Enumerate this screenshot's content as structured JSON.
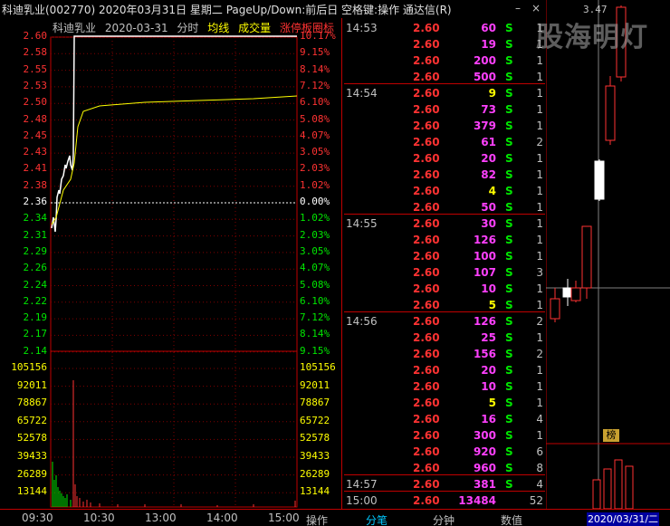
{
  "title": "科迪乳业(002770)  2020年03月31日 星期二  PageUp/Down:前后日  空格键:操作  通达信(R)",
  "window_controls": {
    "minimize": "–",
    "close": "×"
  },
  "chart_header": {
    "name": "科迪乳业",
    "date": "2020-03-31",
    "mode": "分时",
    "avg_label": "均线",
    "vol_label": "成交量",
    "limit_label": "涨停板圈标"
  },
  "chart_data": {
    "type": "line",
    "price_axis_left": [
      "2.60",
      "2.58",
      "2.55",
      "2.53",
      "2.50",
      "2.48",
      "2.45",
      "2.43",
      "2.41",
      "2.38",
      "2.36",
      "2.34",
      "2.31",
      "2.29",
      "2.26",
      "2.24",
      "2.22",
      "2.19",
      "2.17",
      "2.14"
    ],
    "price_axis_right": [
      "10.17%",
      "9.15%",
      "8.14%",
      "7.12%",
      "6.10%",
      "5.08%",
      "4.07%",
      "3.05%",
      "2.03%",
      "1.02%",
      "0.00%",
      "1.02%",
      "2.03%",
      "3.05%",
      "4.07%",
      "5.08%",
      "6.10%",
      "7.12%",
      "8.14%",
      "9.15%"
    ],
    "volume_axis": [
      "105156",
      "92011",
      "78867",
      "65722",
      "52578",
      "39433",
      "26289",
      "13144"
    ],
    "x_ticks": [
      "09:30",
      "10:30",
      "13:00",
      "14:00",
      "15:00"
    ],
    "prev_close": 2.36,
    "ylim": [
      2.13,
      2.61
    ]
  },
  "ticks": [
    {
      "time": "14:53",
      "price": "2.60",
      "vol": "60",
      "dir": "S",
      "cnt": "1"
    },
    {
      "time": "",
      "price": "2.60",
      "vol": "19",
      "dir": "S",
      "cnt": "1"
    },
    {
      "time": "",
      "price": "2.60",
      "vol": "200",
      "dir": "S",
      "cnt": "1"
    },
    {
      "time": "",
      "price": "2.60",
      "vol": "500",
      "dir": "S",
      "cnt": "1"
    },
    {
      "time": "14:54",
      "price": "2.60",
      "vol": "9",
      "dir": "S",
      "cnt": "1",
      "yellow": true
    },
    {
      "time": "",
      "price": "2.60",
      "vol": "73",
      "dir": "S",
      "cnt": "1"
    },
    {
      "time": "",
      "price": "2.60",
      "vol": "379",
      "dir": "S",
      "cnt": "1"
    },
    {
      "time": "",
      "price": "2.60",
      "vol": "61",
      "dir": "S",
      "cnt": "2"
    },
    {
      "time": "",
      "price": "2.60",
      "vol": "20",
      "dir": "S",
      "cnt": "1"
    },
    {
      "time": "",
      "price": "2.60",
      "vol": "82",
      "dir": "S",
      "cnt": "1"
    },
    {
      "time": "",
      "price": "2.60",
      "vol": "4",
      "dir": "S",
      "cnt": "1",
      "yellow": true
    },
    {
      "time": "",
      "price": "2.60",
      "vol": "50",
      "dir": "S",
      "cnt": "1"
    },
    {
      "time": "14:55",
      "price": "2.60",
      "vol": "30",
      "dir": "S",
      "cnt": "1"
    },
    {
      "time": "",
      "price": "2.60",
      "vol": "126",
      "dir": "S",
      "cnt": "1"
    },
    {
      "time": "",
      "price": "2.60",
      "vol": "100",
      "dir": "S",
      "cnt": "1"
    },
    {
      "time": "",
      "price": "2.60",
      "vol": "107",
      "dir": "S",
      "cnt": "3"
    },
    {
      "time": "",
      "price": "2.60",
      "vol": "10",
      "dir": "S",
      "cnt": "1"
    },
    {
      "time": "",
      "price": "2.60",
      "vol": "5",
      "dir": "S",
      "cnt": "1",
      "yellow": true
    },
    {
      "time": "14:56",
      "price": "2.60",
      "vol": "126",
      "dir": "S",
      "cnt": "2"
    },
    {
      "time": "",
      "price": "2.60",
      "vol": "25",
      "dir": "S",
      "cnt": "1"
    },
    {
      "time": "",
      "price": "2.60",
      "vol": "156",
      "dir": "S",
      "cnt": "2"
    },
    {
      "time": "",
      "price": "2.60",
      "vol": "20",
      "dir": "S",
      "cnt": "1"
    },
    {
      "time": "",
      "price": "2.60",
      "vol": "10",
      "dir": "S",
      "cnt": "1"
    },
    {
      "time": "",
      "price": "2.60",
      "vol": "5",
      "dir": "S",
      "cnt": "1",
      "yellow": true
    },
    {
      "time": "",
      "price": "2.60",
      "vol": "16",
      "dir": "S",
      "cnt": "4"
    },
    {
      "time": "",
      "price": "2.60",
      "vol": "300",
      "dir": "S",
      "cnt": "1"
    },
    {
      "time": "",
      "price": "2.60",
      "vol": "920",
      "dir": "S",
      "cnt": "6"
    },
    {
      "time": "",
      "price": "2.60",
      "vol": "960",
      "dir": "S",
      "cnt": "8"
    },
    {
      "time": "14:57",
      "price": "2.60",
      "vol": "381",
      "dir": "S",
      "cnt": "4"
    },
    {
      "time": "15:00",
      "price": "2.60",
      "vol": "13484",
      "dir": "",
      "cnt": "52"
    }
  ],
  "kline": {
    "top_label": "3.47",
    "badge": "榜",
    "date": "2020/03/31/二"
  },
  "watermark": "股海明灯",
  "tabs": [
    "操作",
    "分笔",
    "分钟",
    "数值"
  ],
  "colors": {
    "up": "#ff3232",
    "down": "#00e600",
    "avg": "#ffff00",
    "price": "#ffffff",
    "grid": "#c00000"
  }
}
